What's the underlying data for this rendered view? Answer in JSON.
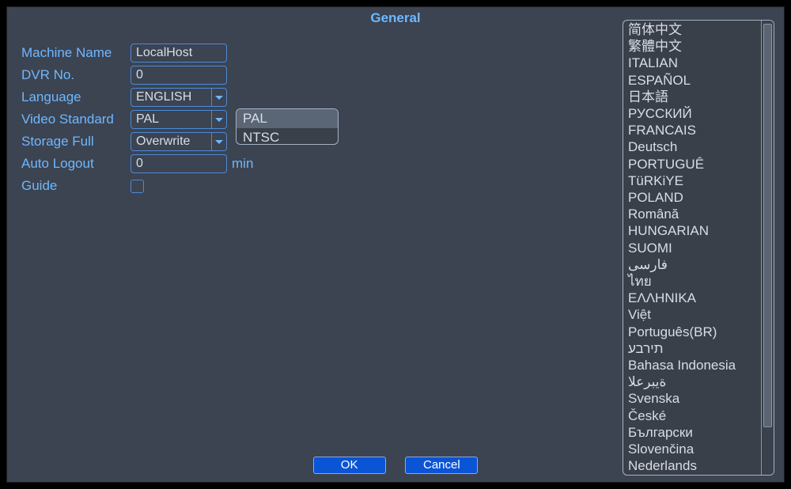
{
  "title": "General",
  "form": {
    "machine_name_label": "Machine Name",
    "machine_name_value": "LocalHost",
    "dvr_no_label": "DVR No.",
    "dvr_no_value": "0",
    "language_label": "Language",
    "language_value": "ENGLISH",
    "video_std_label": "Video Standard",
    "video_std_value": "PAL",
    "storage_full_label": "Storage Full",
    "storage_full_value": "Overwrite",
    "auto_logout_label": "Auto Logout",
    "auto_logout_value": "0",
    "auto_logout_unit": "min",
    "guide_label": "Guide"
  },
  "video_options": {
    "opt0": "PAL",
    "opt1": "NTSC"
  },
  "languages": {
    "l0": "简体中文",
    "l1": "繁體中文",
    "l2": "ITALIAN",
    "l3": "ESPAÑOL",
    "l4": "日本語",
    "l5": "РУССКИЙ",
    "l6": "FRANCAIS",
    "l7": "Deutsch",
    "l8": "PORTUGUÊ",
    "l9": "TüRKiYE",
    "l10": "POLAND",
    "l11": "Română",
    "l12": "HUNGARIAN",
    "l13": "SUOMI",
    "l14": "فارسی",
    "l15": "ไทย",
    "l16": "ΕΛΛΗΝΙΚΑ",
    "l17": "Việt",
    "l18": "Português(BR)",
    "l19": "תירבע",
    "l20": "Bahasa Indonesia",
    "l21": "ةيبرعلا",
    "l22": "Svenska",
    "l23": "České",
    "l24": "Български",
    "l25": "Slovenčina",
    "l26": "Nederlands"
  },
  "buttons": {
    "ok": "OK",
    "cancel": "Cancel"
  }
}
